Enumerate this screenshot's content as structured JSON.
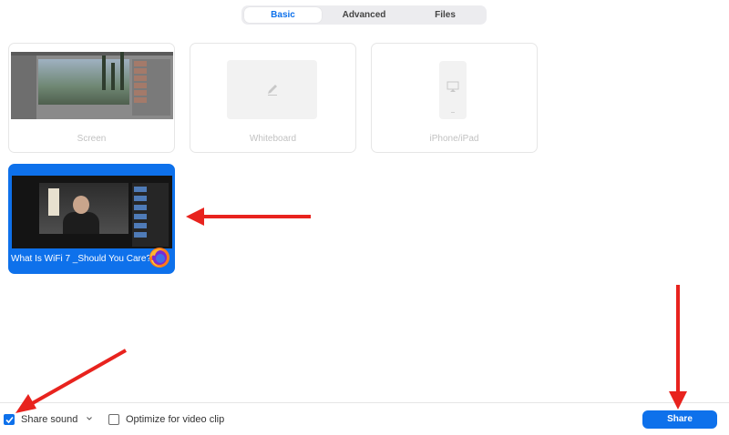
{
  "tabs": [
    {
      "label": "Basic",
      "active": true
    },
    {
      "label": "Advanced",
      "active": false
    },
    {
      "label": "Files",
      "active": false
    }
  ],
  "sources": [
    {
      "label": "Screen",
      "icon": "screen-preview"
    },
    {
      "label": "Whiteboard",
      "icon": "pencil-icon"
    },
    {
      "label": "iPhone/iPad",
      "icon": "airplay-icon"
    }
  ],
  "selected_window": {
    "title": "What Is WiFi 7 _Should You Care? ...",
    "app_icon": "firefox-icon",
    "selected": true
  },
  "footer": {
    "share_sound_label": "Share sound",
    "share_sound_checked": true,
    "optimize_label": "Optimize for video clip",
    "optimize_checked": false,
    "share_button_label": "Share"
  },
  "colors": {
    "accent": "#0e71eb",
    "annotation_arrow": "#e8231e",
    "disabled_text": "#c2c2c2"
  }
}
